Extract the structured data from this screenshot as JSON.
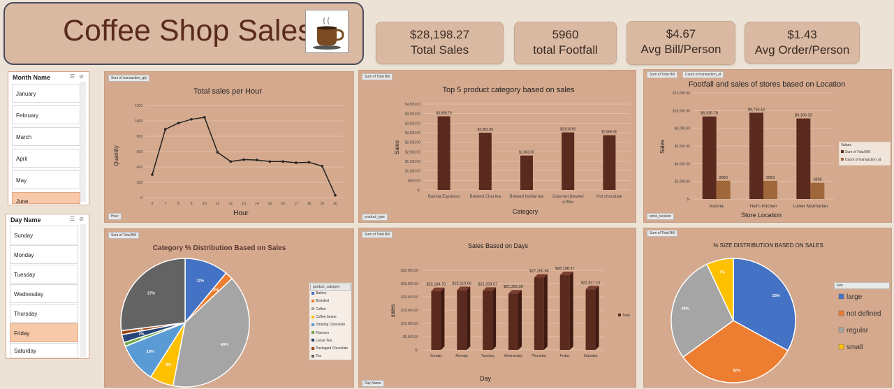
{
  "header": {
    "title": "Coffee Shop Sales"
  },
  "kpis": [
    {
      "value": "$28,198.27",
      "label": "Total Sales"
    },
    {
      "value": "5960",
      "label": "total Footfall"
    },
    {
      "value": "$4.67",
      "label": "Avg Bill/Person"
    },
    {
      "value": "$1.43",
      "label": "Avg Order/Person"
    }
  ],
  "month_slicer": {
    "title": "Month Name",
    "items": [
      "January",
      "February",
      "March",
      "April",
      "May",
      "June"
    ],
    "selected": "June"
  },
  "day_slicer": {
    "title": "Day Name",
    "items": [
      "Sunday",
      "Monday",
      "Tuesday",
      "Wednesday",
      "Thursday",
      "Friday",
      "Saturday"
    ],
    "selected": "Friday"
  },
  "colors": {
    "bar": "#5a2a1f",
    "bar2": "#a0673a",
    "panel": "#d5a98d"
  },
  "field_buttons": {
    "hourly_value": "Sum of transaction_qty",
    "hourly_axis": "Hour",
    "top5_value": "Sum of Total Bill",
    "top5_axis": "product_type",
    "store_value1": "Sum of Total Bill",
    "store_value2": "Count of transaction_id",
    "store_axis": "store_location",
    "category_value": "Sum of Total Bill",
    "category_legend": "product_category",
    "days_value": "Sum of Total Bill",
    "days_axis": "Day Name",
    "size_value": "Sum of Total Bill",
    "size_legend": "size"
  },
  "chart_data": [
    {
      "type": "line",
      "title": "Total sales per Hour",
      "xlabel": "Hour",
      "ylabel": "Quantity",
      "x": [
        6,
        7,
        8,
        9,
        10,
        11,
        12,
        13,
        14,
        15,
        16,
        17,
        18,
        19,
        20
      ],
      "values": [
        300,
        890,
        970,
        1020,
        1045,
        590,
        470,
        495,
        490,
        470,
        470,
        455,
        460,
        410,
        30
      ],
      "ylim": [
        0,
        1200
      ],
      "yticks": [
        "0",
        "200",
        "400",
        "600",
        "800",
        "1000",
        "1200"
      ],
      "grid": true
    },
    {
      "type": "bar",
      "title": "Top 5 product category based on sales",
      "xlabel": "Category",
      "ylabel": "Sales",
      "categories": [
        "Barista Espresso",
        "Brewed Chai tea",
        "Brewed herbal tea",
        "Gourmet brewed coffee",
        "Hot chocolate"
      ],
      "values": [
        3858.7,
        3002.65,
        1803.0,
        3016.9,
        2866.5
      ],
      "data_labels": [
        "$3,858.70",
        "$3,002.65",
        "$1,803.00",
        "$3,016.90",
        "$2,866.50"
      ],
      "ylim": [
        0,
        4500
      ],
      "yticks": [
        "$-",
        "$500.00",
        "$1,000.00",
        "$1,500.00",
        "$2,000.00",
        "$2,500.00",
        "$3,000.00",
        "$3,500.00",
        "$4,000.00",
        "$4,500.00"
      ]
    },
    {
      "type": "bar",
      "title": "Footfall and sales of stores based on Location",
      "xlabel": "Store Location",
      "ylabel": "Sales",
      "categories": [
        "Astoria",
        "Hell's Kitchen",
        "Lower Manhattan"
      ],
      "series": [
        {
          "name": "Sum of Total Bill",
          "values": [
            9335.78,
            9756.16,
            9106.33
          ],
          "labels": [
            "$9,335.78",
            "$9,756.16",
            "$9,106.33"
          ]
        },
        {
          "name": "Count of transaction_id",
          "values": [
            2069,
            2053,
            1838
          ],
          "labels": [
            "2069",
            "2053",
            "1838"
          ]
        }
      ],
      "legend_title": "Values",
      "ylim": [
        0,
        12000
      ],
      "yticks": [
        "$-",
        "$2,000.00",
        "$4,000.00",
        "$6,000.00",
        "$8,000.00",
        "$10,000.00",
        "$12,000.00"
      ],
      "legend": "right"
    },
    {
      "type": "pie",
      "title": "Category % Distribution Based on Sales",
      "legend_title": "product_category",
      "legend_items": [
        "Bakery",
        "Branded",
        "Coffee",
        "Coffee beans",
        "Drinking Chocolate",
        "Flavours",
        "Loose Tea",
        "Packaged Chocolate",
        "Tea"
      ],
      "slices": [
        {
          "label": "11%",
          "value": 11,
          "color": "#4472c4"
        },
        {
          "label": "2%",
          "value": 2,
          "color": "#ed7d31"
        },
        {
          "label": "40%",
          "value": 40,
          "color": "#a5a5a5"
        },
        {
          "label": "6%",
          "value": 6,
          "color": "#ffc000"
        },
        {
          "label": "10%",
          "value": 10,
          "color": "#5b9bd5"
        },
        {
          "label": "1%",
          "value": 1,
          "color": "#70ad47"
        },
        {
          "label": "2%",
          "value": 2,
          "color": "#264478"
        },
        {
          "label": "1%",
          "value": 1,
          "color": "#9e480e"
        },
        {
          "label": "27%",
          "value": 27,
          "color": "#636363"
        }
      ],
      "legend": "right"
    },
    {
      "type": "bar",
      "title": "Sales Based on Days",
      "xlabel": "Day",
      "ylabel": "sales",
      "categories": [
        "Sunday",
        "Monday",
        "Tuesday",
        "Wednesday",
        "Thursday",
        "Friday",
        "Saturday"
      ],
      "values": [
        22184.7,
        22519.66,
        22258.57,
        21256.9,
        27250.68,
        28198.27,
        22817.1
      ],
      "data_labels": [
        "$22,184.70",
        "$22,519.66",
        "$22,258.57",
        "$21,256.90",
        "$27,250.68",
        "$28,198.27",
        "$22,817.10"
      ],
      "ylim": [
        0,
        30000
      ],
      "yticks": [
        "$-",
        "$5,000.00",
        "$10,000.00",
        "$15,000.00",
        "$20,000.00",
        "$25,000.00",
        "$30,000.00"
      ],
      "series_name": "Total",
      "legend": "right"
    },
    {
      "type": "pie",
      "title": "% SIZE DISTRIBUTION BASED ON SALES",
      "slices": [
        {
          "name": "large",
          "label": "33%",
          "value": 33,
          "color": "#4472c4"
        },
        {
          "name": "not defined",
          "label": "32%",
          "value": 32,
          "color": "#ed7d31"
        },
        {
          "name": "regular",
          "label": "28%",
          "value": 28,
          "color": "#a5a5a5"
        },
        {
          "name": "small",
          "label": "7%",
          "value": 7,
          "color": "#ffc000"
        }
      ],
      "legend": "right"
    }
  ]
}
